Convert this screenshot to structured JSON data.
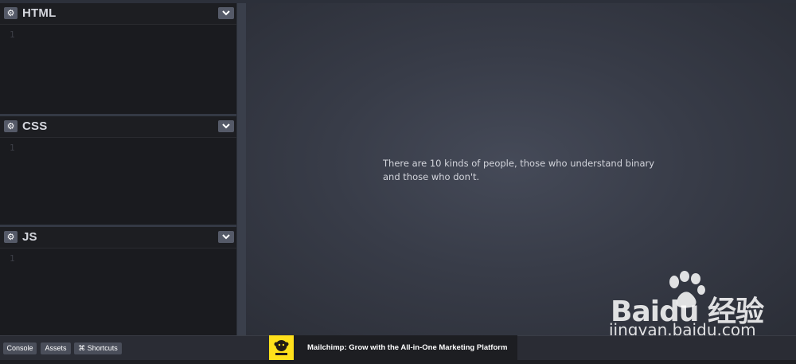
{
  "editors": [
    {
      "title": "HTML",
      "line": "1"
    },
    {
      "title": "CSS",
      "line": "1"
    },
    {
      "title": "JS",
      "line": "1"
    }
  ],
  "preview": {
    "text": "There are 10 kinds of people, those who understand binary and those who don't."
  },
  "footer": {
    "console_label": "Console",
    "assets_label": "Assets",
    "shortcuts_label": "⌘ Shortcuts"
  },
  "ad": {
    "text": "Mailchimp: Grow with the All-in-One Marketing Platform"
  },
  "watermark": {
    "brand": "Baidu 经验",
    "url": "jingyan.baidu.com"
  },
  "icons": {
    "settings": "gear-icon",
    "collapse": "chevron-down-icon",
    "ad_logo": "mailchimp-logo",
    "watermark_logo": "baidu-paw-logo"
  }
}
